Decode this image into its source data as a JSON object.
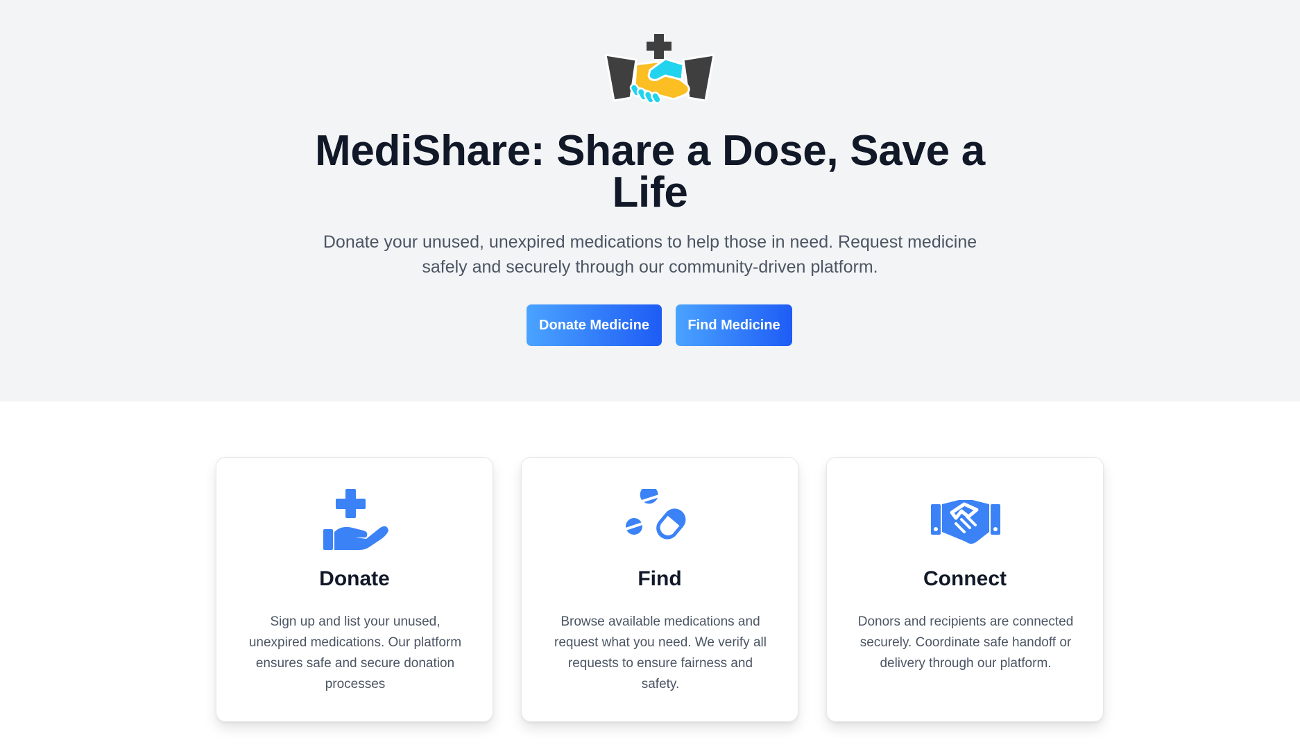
{
  "hero": {
    "logo_icon": "medishare-handshake-cross-icon",
    "title": "MediShare: Share a Dose, Save a Life",
    "subtitle": "Donate your unused, unexpired medications to help those in need. Request medicine safely and securely through our community-driven platform.",
    "buttons": {
      "donate_label": "Donate Medicine",
      "find_label": "Find Medicine"
    }
  },
  "features": [
    {
      "icon": "hand-holding-medical-icon",
      "title": "Donate",
      "text": "Sign up and list your unused, unexpired medications. Our platform ensures safe and secure donation processes"
    },
    {
      "icon": "pills-icon",
      "title": "Find",
      "text": "Browse available medications and request what you need. We verify all requests to ensure fairness and safety."
    },
    {
      "icon": "handshake-icon",
      "title": "Connect",
      "text": "Donors and recipients are connected securely. Coordinate safe handoff or delivery through our platform."
    }
  ],
  "colors": {
    "hero_background": "#f3f4f6",
    "accent_blue": "#3b82f6",
    "button_gradient_start": "#4aa3ff",
    "button_gradient_end": "#1e5cf5",
    "title_text": "#111827",
    "body_text": "#4b5563",
    "logo_dark": "#3f3f3f",
    "logo_yellow": "#fbbf24",
    "logo_cyan": "#22d3ee"
  }
}
